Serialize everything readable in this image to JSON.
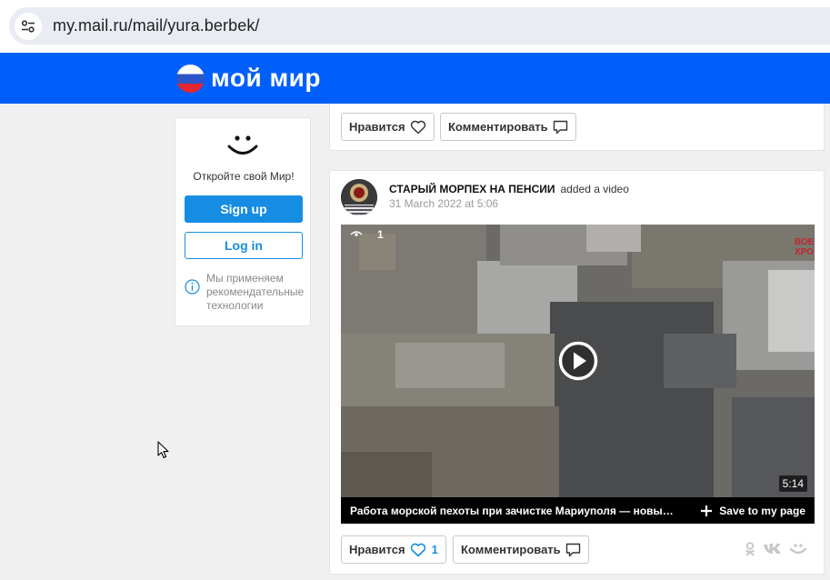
{
  "browser": {
    "url": "my.mail.ru/mail/yura.berbek/"
  },
  "header": {
    "logo_text": "мой мир",
    "brand_color": "#005ff9"
  },
  "sidebar": {
    "tagline": "Откройте свой Мир!",
    "signup_label": "Sign up",
    "login_label": "Log in",
    "recommend_lines": [
      "Мы применяем",
      "рекомендательные",
      "технологии"
    ]
  },
  "previous_post": {
    "like_label": "Нравится",
    "comment_label": "Комментировать"
  },
  "post": {
    "author": "СТАРЫЙ МОРПЕХ НА ПЕНСИИ",
    "action": "added a video",
    "date": "31 March 2022 at 5:06",
    "video": {
      "views": "1",
      "duration": "5:14",
      "title": "Работа морской пехоты при зачистке Мариуполя — новы…",
      "save_label": "Save to my page",
      "brand_lines": [
        "ВОЕ",
        "ХРО"
      ]
    },
    "like_label": "Нравится",
    "like_count": "1",
    "comment_label": "Комментировать",
    "share_icons": [
      "odnoklassniki-icon",
      "vk-icon",
      "moimir-icon"
    ]
  }
}
